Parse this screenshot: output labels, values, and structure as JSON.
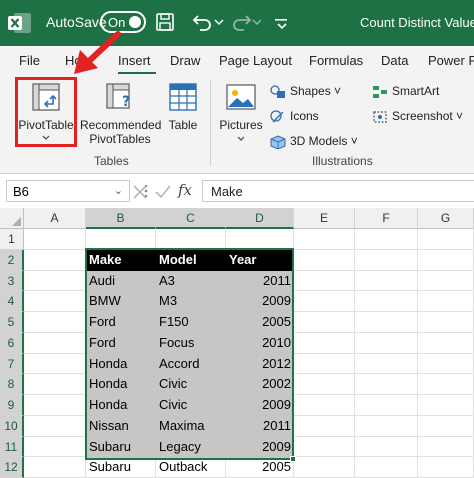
{
  "titlebar": {
    "autosave_label": "AutoSave",
    "toggle_state": "On",
    "doc_title": "Count Distinct Values.x"
  },
  "tabs": [
    {
      "label": "File"
    },
    {
      "label": "Ho"
    },
    {
      "label": "Insert"
    },
    {
      "label": "Draw"
    },
    {
      "label": "Page Layout"
    },
    {
      "label": "Formulas"
    },
    {
      "label": "Data"
    },
    {
      "label": "Power P"
    }
  ],
  "ribbon": {
    "pivot_table": "PivotTable",
    "recommended_line1": "Recommended",
    "recommended_line2": "PivotTables",
    "table": "Table",
    "tables_group": "Tables",
    "pictures": "Pictures",
    "shapes": "Shapes",
    "icons": "Icons",
    "models3d": "3D Models",
    "smartart": "SmartArt",
    "screenshot": "Screenshot",
    "illustrations_group": "Illustrations"
  },
  "formula_bar": {
    "name_box": "B6",
    "fx": "fx",
    "value": "Make"
  },
  "grid": {
    "columns": [
      "A",
      "B",
      "C",
      "D",
      "E",
      "F",
      "G"
    ],
    "rows": [
      "1",
      "2",
      "3",
      "4",
      "5",
      "6",
      "7",
      "8",
      "9",
      "10",
      "11",
      "12"
    ],
    "headers": [
      "Make",
      "Model",
      "Year"
    ],
    "data": [
      [
        "Audi",
        "A3",
        "2011"
      ],
      [
        "BMW",
        "M3",
        "2009"
      ],
      [
        "Ford",
        "F150",
        "2005"
      ],
      [
        "Ford",
        "Focus",
        "2010"
      ],
      [
        "Honda",
        "Accord",
        "2012"
      ],
      [
        "Honda",
        "Civic",
        "2002"
      ],
      [
        "Honda",
        "Civic",
        "2009"
      ],
      [
        "Nissan",
        "Maxima",
        "2011"
      ],
      [
        "Subaru",
        "Legacy",
        "2009"
      ],
      [
        "Subaru",
        "Outback",
        "2005"
      ]
    ]
  },
  "colors": {
    "excel_green": "#1e7145",
    "highlight_red": "#e32121",
    "selection_gray": "#c6c6c6"
  }
}
